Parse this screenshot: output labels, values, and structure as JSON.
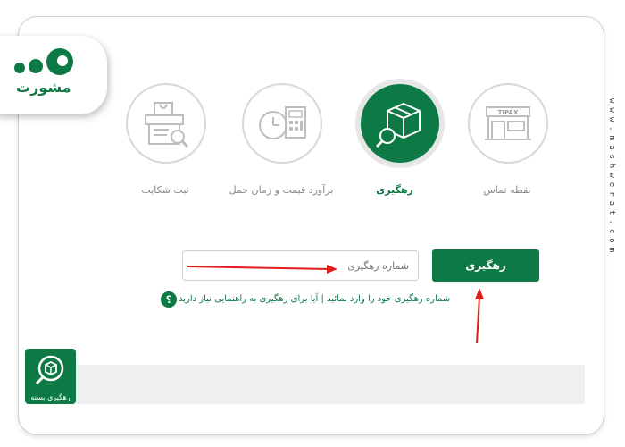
{
  "brand": {
    "name": "مشورت",
    "accent": "#0d7a45"
  },
  "side_url": "www.mashwerat.com",
  "nav": [
    {
      "label": "ثبت شکایت",
      "icon": "complaint-icon",
      "active": false
    },
    {
      "label": "برآورد قیمت و زمان حمل",
      "icon": "price-estimate-icon",
      "active": false
    },
    {
      "label": "رهگیری",
      "icon": "tracking-icon",
      "active": true
    },
    {
      "label": "نقطه تماس",
      "icon": "contact-point-icon",
      "active": false
    }
  ],
  "store_sign": "TIPAX",
  "search": {
    "placeholder": "شماره رهگیری",
    "button_label": "رهگیری",
    "hint": "شماره رهگیری خود را وارد نمائید | آیا برای رهگیری به راهنمایی نیاز دارید",
    "help_symbol": "؟"
  },
  "package_card": {
    "label": "رهگیری بسته"
  }
}
